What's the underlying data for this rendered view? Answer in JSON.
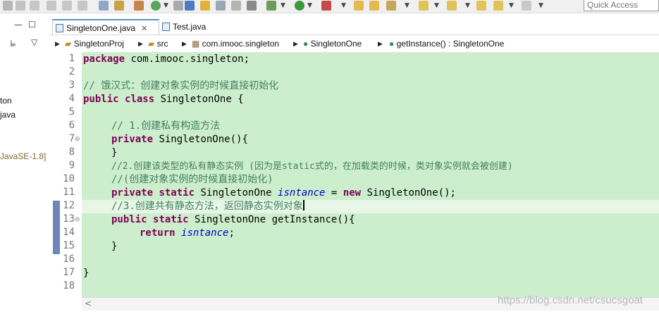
{
  "toolbar": {
    "quick_access_placeholder": "Quick Access"
  },
  "left_panel": {
    "items": [
      {
        "label": "ton"
      },
      {
        "label": "java"
      },
      {
        "label": "JavaSE-1.8]"
      }
    ]
  },
  "tabs": [
    {
      "label": "SingletonOne.java",
      "close": "✕"
    },
    {
      "label": "Test.java"
    }
  ],
  "breadcrumb": [
    {
      "label": "SingletonProj"
    },
    {
      "label": "src"
    },
    {
      "label": "com.imooc.singleton"
    },
    {
      "label": "SingletonOne"
    },
    {
      "label": "getInstance() : SingletonOne"
    }
  ],
  "editor": {
    "line_numbers": [
      "1",
      "2",
      "3",
      "4",
      "5",
      "6",
      "7",
      "8",
      "9",
      "10",
      "11",
      "12",
      "13",
      "14",
      "15",
      "16",
      "17",
      "18"
    ],
    "lines": {
      "l1_kw": "package",
      "l1_rest": " com.imooc.singleton;",
      "l3": "// 饿汉式：创建对象实例的时候直接初始化",
      "l4_kw1": "public",
      "l4_kw2": "class",
      "l4_rest": " SingletonOne {",
      "l6": "// 1.创建私有构造方法",
      "l7_kw": "private",
      "l7_rest": " SingletonOne(){",
      "l8": "}",
      "l9": "//2.创建该类型的私有静态实例 (因为是static式的，在加载类的时候，类对象实例就会被创建)",
      "l10": "//(创建对象实例的时候直接初始化)",
      "l11_kw1": "private",
      "l11_kw2": "static",
      "l11_mid": " SingletonOne ",
      "l11_field": "isntance",
      "l11_eq": " = ",
      "l11_kw3": "new",
      "l11_rest": " SingletonOne();",
      "l12": "//3.创建共有静态方法，返回静态实例对象",
      "l13_kw1": "public",
      "l13_kw2": "static",
      "l13_rest": " SingletonOne getInstance(){",
      "l14_kw": "return",
      "l14_field": "isntance",
      "l14_semi": ";",
      "l15": "}",
      "l17": "}"
    }
  },
  "watermark": "https://blog.csdn.net/csucsgoat"
}
